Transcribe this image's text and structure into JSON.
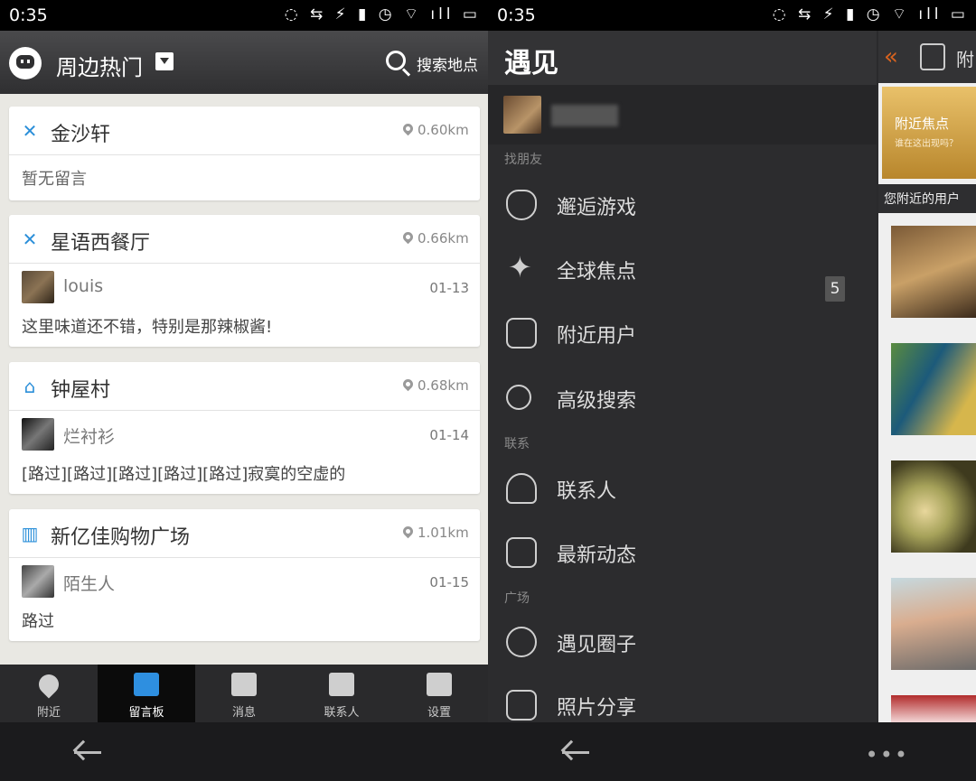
{
  "status_time": "0:35",
  "status_icons": "◌ ⇆ ⚡ ▮ ◷ ⌔ ıll ▭",
  "left": {
    "header": {
      "title": "周边热门",
      "search_label": "搜索地点"
    },
    "cards": [
      {
        "name": "金沙轩",
        "icon": "✕",
        "distance": "0.60km",
        "message": "暂无留言"
      },
      {
        "name": "星语西餐厅",
        "icon": "✕",
        "distance": "0.66km",
        "user": "louis",
        "date": "01-13",
        "message": "这里味道还不错，特别是那辣椒酱!"
      },
      {
        "name": "钟屋村",
        "icon": "⌂",
        "distance": "0.68km",
        "user": "烂衬衫",
        "date": "01-14",
        "message": "[路过][路过][路过][路过][路过]寂寞的空虚的"
      },
      {
        "name": "新亿佳购物广场",
        "icon": "▥",
        "distance": "1.01km",
        "user": "陌生人",
        "date": "01-15",
        "message": "路过"
      }
    ],
    "tabs": [
      {
        "label": "附近"
      },
      {
        "label": "留言板"
      },
      {
        "label": "消息"
      },
      {
        "label": "联系人"
      },
      {
        "label": "设置"
      }
    ]
  },
  "right": {
    "brand": "遇见",
    "sections": {
      "find_friends": "找朋友",
      "contact": "联系",
      "plaza": "广场"
    },
    "items": {
      "encounter_game": "邂逅游戏",
      "global_focus": "全球焦点",
      "nearby_users": "附近用户",
      "advanced_search": "高级搜索",
      "contacts": "联系人",
      "latest_updates": "最新动态",
      "circles": "遇见圈子",
      "photo_share": "照片分享"
    },
    "badge": "5",
    "peek": {
      "chevron": "«",
      "title": "附",
      "banner_title": "附近焦点",
      "banner_sub": "谁在这出现吗？",
      "nearby_label": "您附近的用户"
    },
    "more": "•••"
  },
  "colors": {
    "accent_blue": "#2e8fe0",
    "accent_orange": "#d8631f"
  }
}
